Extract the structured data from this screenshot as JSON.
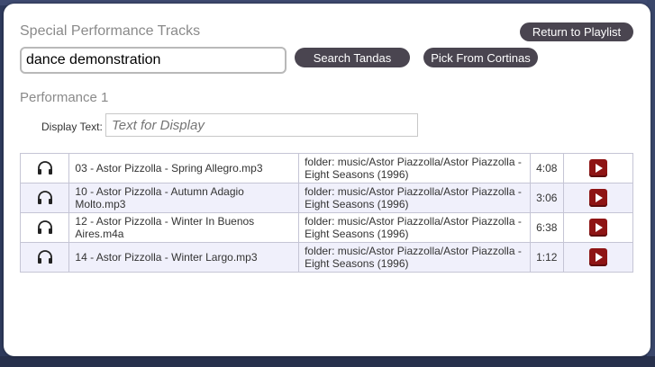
{
  "dialog": {
    "title": "Special Performance Tracks",
    "return_label": "Return to Playlist",
    "search": {
      "value": "dance demonstration"
    },
    "search_btn_label": "Search Tandas",
    "cortinas_btn_label": "Pick From Cortinas"
  },
  "performance": {
    "title": "Performance 1",
    "display_label": "Display Text:",
    "display_placeholder": "Text for Display"
  },
  "tracks": [
    {
      "name": "03 - Astor Pizzolla - Spring Allegro.mp3",
      "folder": "folder: music/Astor Piazzolla/Astor Piazzolla - Eight Seasons (1996)",
      "duration": "4:08"
    },
    {
      "name": "10 - Astor Pizzolla - Autumn Adagio Molto.mp3",
      "folder": "folder: music/Astor Piazzolla/Astor Piazzolla - Eight Seasons (1996)",
      "duration": "3:06"
    },
    {
      "name": "12 - Astor Pizzolla - Winter In Buenos Aires.m4a",
      "folder": "folder: music/Astor Piazzolla/Astor Piazzolla - Eight Seasons (1996)",
      "duration": "6:38"
    },
    {
      "name": "14 - Astor Pizzolla - Winter Largo.mp3",
      "folder": "folder: music/Astor Piazzolla/Astor Piazzolla - Eight Seasons (1996)",
      "duration": "1:12"
    }
  ],
  "colors": {
    "button": "#4a4550",
    "play": "#8e1414",
    "row_alt": "#f0f0fb"
  },
  "icons": {
    "track": "headphones-icon",
    "play": "play-icon"
  }
}
